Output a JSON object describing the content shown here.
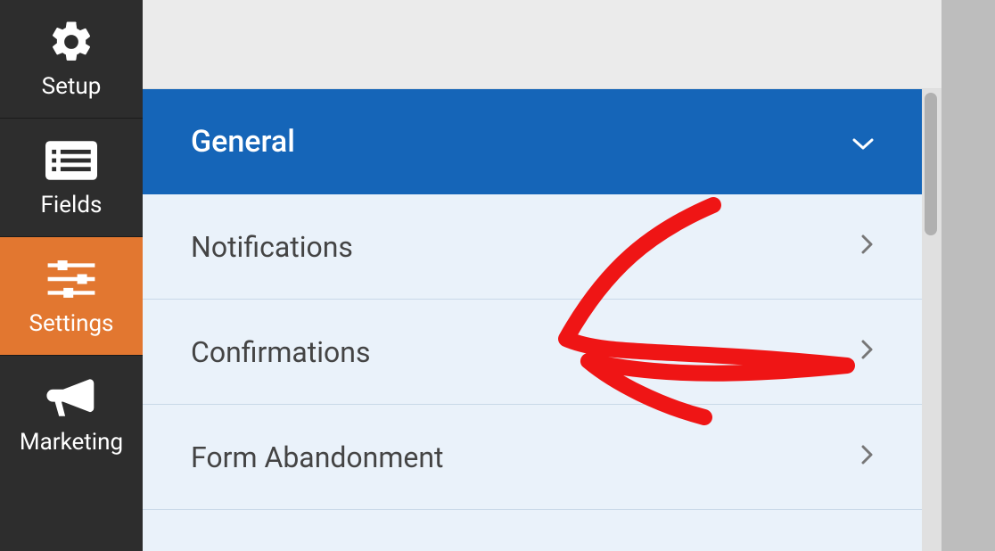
{
  "sidebar": {
    "items": [
      {
        "label": "Setup"
      },
      {
        "label": "Fields"
      },
      {
        "label": "Settings"
      },
      {
        "label": "Marketing"
      }
    ]
  },
  "panel": {
    "header": {
      "title": "General"
    },
    "rows": [
      {
        "label": "Notifications"
      },
      {
        "label": "Confirmations"
      },
      {
        "label": "Form Abandonment"
      }
    ]
  }
}
